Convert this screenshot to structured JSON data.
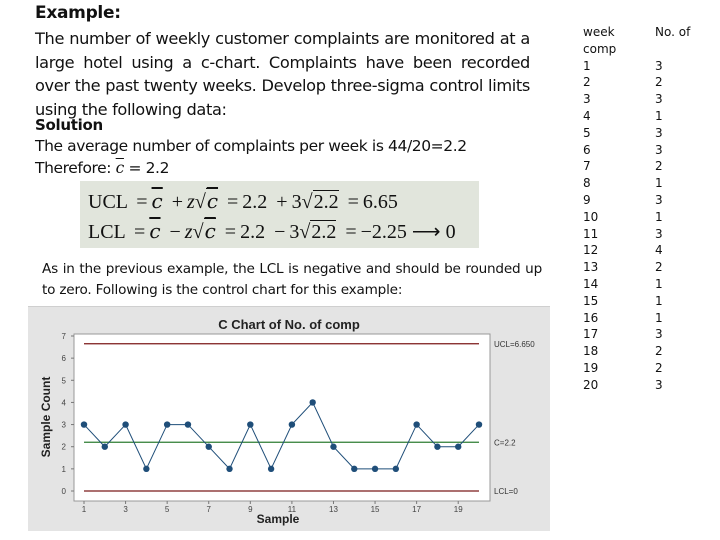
{
  "example": {
    "title": "Example:",
    "problem": "The number of weekly customer complaints are monitored at a large hotel using a c-chart. Complaints have been recorded over the past twenty weeks. Develop three-sigma control limits using the following data:"
  },
  "solution": {
    "title": "Solution",
    "average_text": "The average number of complaints per week is 44/20=2.2",
    "therefore_prefix": "Therefore: ",
    "cbar_symbol": "c",
    "therefore_suffix": " = 2.2"
  },
  "formulas": {
    "ucl": {
      "label": "UCL",
      "eq1": "=",
      "cbar": "c",
      "op": "+",
      "z": "z",
      "sqrt_arg": "c",
      "eq2": "=",
      "num": "2.2",
      "op2": "+",
      "coef": "3",
      "sqrt_num": "2.2",
      "eq3": "=",
      "result": "6.65"
    },
    "lcl": {
      "label": "LCL",
      "eq1": "=",
      "cbar": "c",
      "op": "−",
      "z": "z",
      "sqrt_arg": "c",
      "eq2": "=",
      "num": "2.2",
      "op2": "−",
      "coef": "3",
      "sqrt_num": "2.2",
      "eq3": "=",
      "result": "−2.25",
      "arrow": "⟶",
      "rounded": "0"
    }
  },
  "note": "As in the previous example, the LCL is negative and should be rounded up to zero. Following is the control chart for this example:",
  "table": {
    "headers": [
      "week",
      "No. of"
    ],
    "header_row2": [
      "comp",
      ""
    ],
    "rows": [
      [
        "1",
        "3"
      ],
      [
        "2",
        "2"
      ],
      [
        "3",
        "3"
      ],
      [
        "4",
        "1"
      ],
      [
        "5",
        "3"
      ],
      [
        "6",
        "3"
      ],
      [
        "7",
        "2"
      ],
      [
        "8",
        "1"
      ],
      [
        "9",
        "3"
      ],
      [
        "10",
        "1"
      ],
      [
        "11",
        "3"
      ],
      [
        "12",
        "4"
      ],
      [
        "13",
        "2"
      ],
      [
        "14",
        "1"
      ],
      [
        "15",
        "1"
      ],
      [
        "16",
        "1"
      ],
      [
        "17",
        "3"
      ],
      [
        "18",
        "2"
      ],
      [
        "19",
        "2"
      ],
      [
        "20",
        "3"
      ]
    ]
  },
  "chart_data": {
    "type": "line",
    "title": "C Chart of No. of comp",
    "xlabel": "Sample",
    "ylabel": "Sample Count",
    "x": [
      1,
      2,
      3,
      4,
      5,
      6,
      7,
      8,
      9,
      10,
      11,
      12,
      13,
      14,
      15,
      16,
      17,
      18,
      19,
      20
    ],
    "series": [
      {
        "name": "No. of comp",
        "values": [
          3,
          2,
          3,
          1,
          3,
          3,
          2,
          1,
          3,
          1,
          3,
          4,
          2,
          1,
          1,
          1,
          3,
          2,
          2,
          3
        ],
        "color": "#1f4e79"
      }
    ],
    "x_ticks": [
      1,
      3,
      5,
      7,
      9,
      11,
      13,
      15,
      17,
      19
    ],
    "y_ticks": [
      0,
      1,
      2,
      3,
      4,
      5,
      6,
      7
    ],
    "xlim": [
      1,
      20
    ],
    "ylim": [
      0,
      7
    ],
    "reference_lines": [
      {
        "name": "UCL",
        "value": 6.65,
        "label": "UCL=6.650",
        "color": "#7b1a1a"
      },
      {
        "name": "CL",
        "value": 2.2,
        "label": "C=2.2",
        "color": "#2e7d32"
      },
      {
        "name": "LCL",
        "value": 0,
        "label": "LCL=0",
        "color": "#7b1a1a"
      }
    ],
    "grid": false,
    "legend": "none"
  }
}
